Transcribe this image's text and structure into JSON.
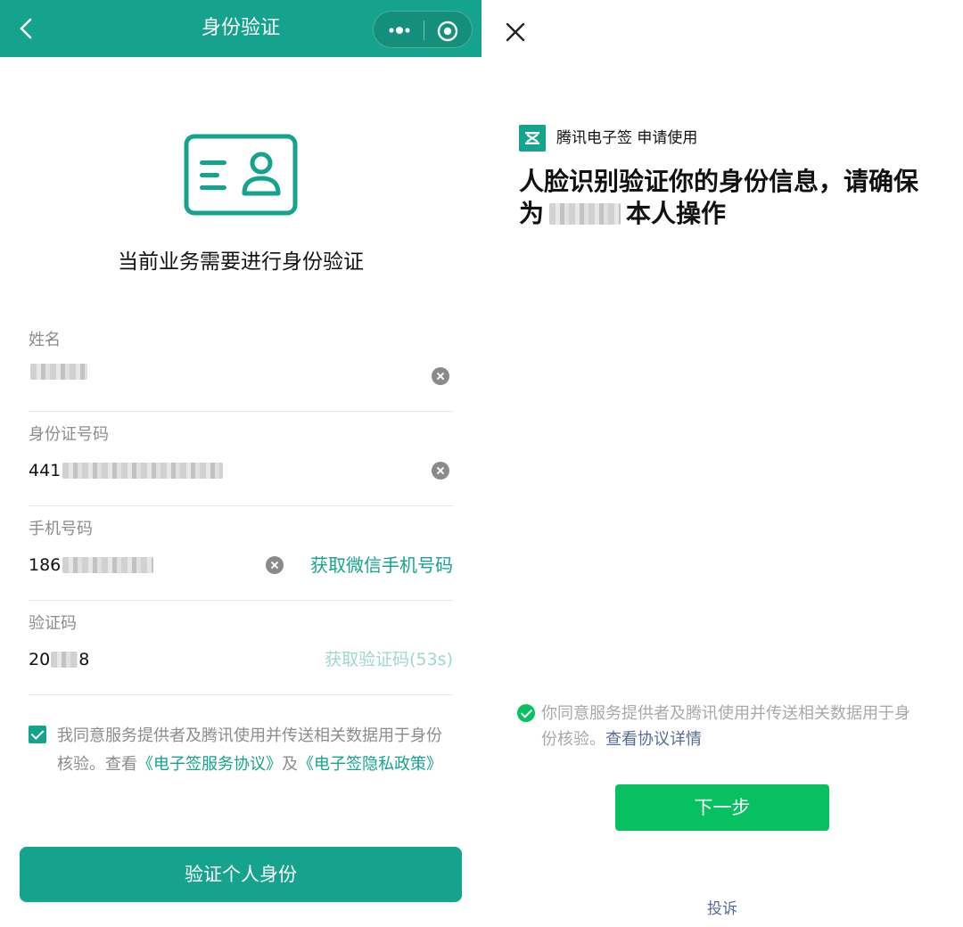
{
  "left_panel": {
    "nav": {
      "title": "身份验证",
      "back_icon": "chevron-left-icon",
      "more_icon": "more-dots-icon",
      "close_icon": "target-close-icon"
    },
    "id_icon": "id-card-icon",
    "headline": "当前业务需要进行身份验证",
    "fields": {
      "name": {
        "label": "姓名",
        "value_visible": ""
      },
      "id_number": {
        "label": "身份证号码",
        "value_visible": "441"
      },
      "phone": {
        "label": "手机号码",
        "value_visible": "186",
        "action": "获取微信手机号码"
      },
      "code": {
        "label": "验证码",
        "value_prefix": "20",
        "value_suffix": "8",
        "action": "获取验证码(53s)"
      }
    },
    "agreement": {
      "checked": true,
      "text_1": "我同意服务提供者及腾讯使用并传送相关数据用于身份核验。查看",
      "link_1": "《电子签服务协议》",
      "text_2": "及",
      "link_2": "《电子签隐私政策》"
    },
    "submit_label": "验证个人身份"
  },
  "right_panel": {
    "close_icon": "close-icon",
    "brand_logo": "tencent-esign-logo",
    "brand_text": "腾讯电子签 申请使用",
    "title_1": "人脸识别验证你的身份信息，请确保为",
    "title_2": "本人操作",
    "agreement": {
      "checked": true,
      "text": "你同意服务提供者及腾讯使用并传送相关数据用于身份核验。",
      "link": "查看协议详情"
    },
    "next_label": "下一步",
    "complain_label": "投诉"
  },
  "colors": {
    "brand_teal": "#16a38e",
    "wechat_green": "#07c160",
    "link_blue": "#576b95"
  }
}
